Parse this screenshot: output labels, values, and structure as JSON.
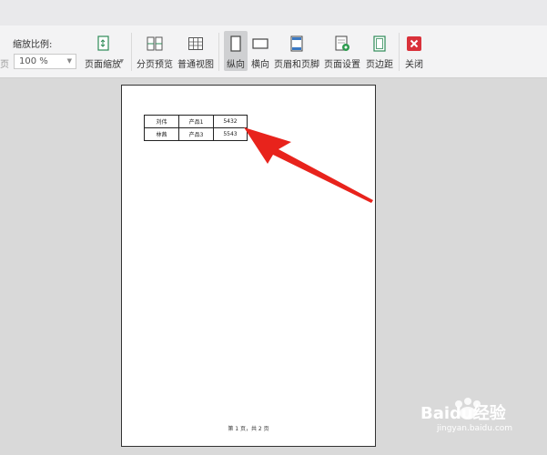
{
  "toolbar": {
    "zoom_label": "缩放比例:",
    "page_fragment": "页",
    "zoom_value": "100 %",
    "page_zoom": "页面缩放",
    "split_preview": "分页预览",
    "normal_view": "普通视图",
    "portrait": "纵向",
    "landscape": "横向",
    "header_footer": "页眉和页脚",
    "page_setup": "页面设置",
    "margins": "页边距",
    "close": "关闭"
  },
  "sheet": {
    "rows": [
      [
        "刘伟",
        "产品1",
        "5432"
      ],
      [
        "林茜",
        "产品3",
        "5543"
      ]
    ],
    "footer": "第 1 页，共 2 页"
  },
  "watermark": {
    "text": "Baidu经验",
    "sub": "jingyan.baidu.com"
  },
  "colors": {
    "close_red": "#d9313a",
    "arrow_red": "#e8231c",
    "active_bg": "#cfd0d2"
  }
}
